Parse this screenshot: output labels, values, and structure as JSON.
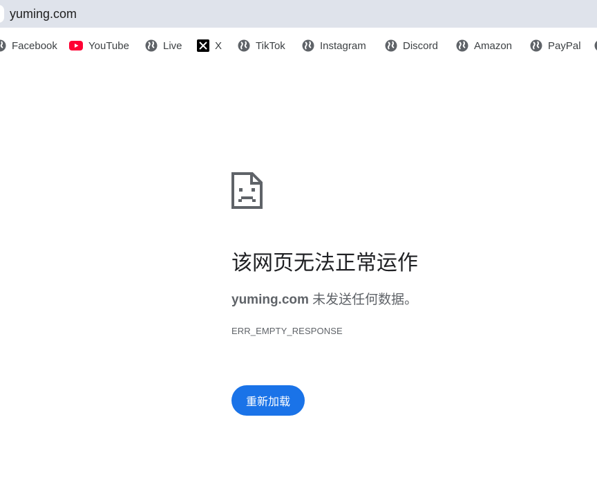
{
  "address_bar": {
    "url": "yuming.com"
  },
  "bookmarks": [
    {
      "label": "Facebook",
      "icon": "globe-icon"
    },
    {
      "label": "YouTube",
      "icon": "youtube-icon"
    },
    {
      "label": "Live",
      "icon": "globe-icon"
    },
    {
      "label": "X",
      "icon": "x-icon"
    },
    {
      "label": "TikTok",
      "icon": "globe-icon"
    },
    {
      "label": "Instagram",
      "icon": "globe-icon"
    },
    {
      "label": "Discord",
      "icon": "globe-icon"
    },
    {
      "label": "Amazon",
      "icon": "globe-icon"
    },
    {
      "label": "PayPal",
      "icon": "globe-icon"
    }
  ],
  "error": {
    "icon": "sad-page-icon",
    "title": "该网页无法正常运作",
    "host": "yuming.com",
    "message": " 未发送任何数据。",
    "code": "ERR_EMPTY_RESPONSE",
    "reload_label": "重新加载"
  },
  "colors": {
    "address_bar_bg": "#dfe3eb",
    "button_bg": "#1a73e8",
    "youtube_red": "#ff0033",
    "text_secondary": "#5f6368"
  }
}
